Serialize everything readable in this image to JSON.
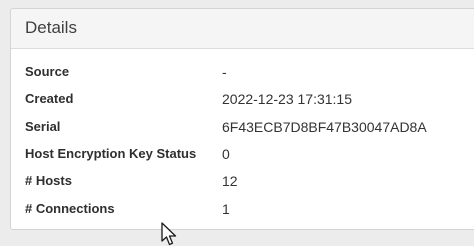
{
  "panel": {
    "title": "Details",
    "rows": [
      {
        "label": "Source",
        "value": "-"
      },
      {
        "label": "Created",
        "value": "2022-12-23 17:31:15"
      },
      {
        "label": "Serial",
        "value": "6F43ECB7D8BF47B30047AD8A"
      },
      {
        "label": "Host Encryption Key Status",
        "value": "0"
      },
      {
        "label": "# Hosts",
        "value": "12"
      },
      {
        "label": "# Connections",
        "value": "1"
      }
    ]
  },
  "cursor": {
    "icon": "mouse-pointer-icon"
  },
  "colors": {
    "background": "#ececec",
    "panel": "#ffffff",
    "header": "#f5f5f5",
    "border": "#d4d4d4",
    "text": "#333333"
  }
}
